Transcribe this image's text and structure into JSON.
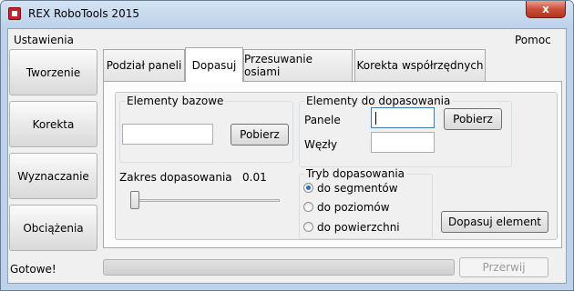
{
  "window": {
    "title": "REX RoboTools 2015",
    "close_glyph": "x"
  },
  "menu": {
    "left": "Ustawienia",
    "right": "Pomoc"
  },
  "sidebar": [
    {
      "label": "Tworzenie"
    },
    {
      "label": "Korekta"
    },
    {
      "label": "Wyznaczanie"
    },
    {
      "label": "Obciążenia"
    }
  ],
  "tabs": [
    {
      "label": "Podział paneli"
    },
    {
      "label": "Dopasuj",
      "active": true
    },
    {
      "label": "Przesuwanie osiami"
    },
    {
      "label": "Korekta współrzędnych"
    }
  ],
  "help_label": "?",
  "base_group": {
    "title": "Elementy bazowe",
    "input_value": "",
    "button": "Pobierz"
  },
  "fit_group": {
    "title": "Elementy do dopasowania",
    "panels_label": "Panele",
    "panels_value": "",
    "nodes_label": "Węzły",
    "nodes_value": "",
    "button": "Pobierz"
  },
  "range": {
    "label": "Zakres dopasowania",
    "value_text": "0.01",
    "slider_fraction": 0.0
  },
  "mode_group": {
    "title": "Tryb dopasowania",
    "options": [
      {
        "label": "do segmentów",
        "checked": true
      },
      {
        "label": "do poziomów",
        "checked": false
      },
      {
        "label": "do powierzchni",
        "checked": false
      }
    ]
  },
  "fit_button": "Dopasuj element",
  "status": {
    "text": "Gotowe!",
    "progress_fraction": 0.0,
    "abort_button": "Przerwij"
  }
}
